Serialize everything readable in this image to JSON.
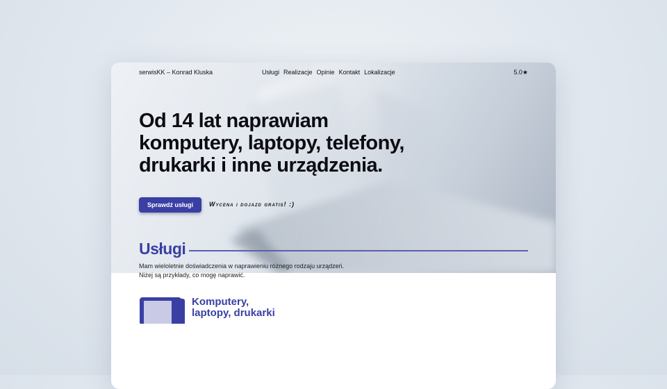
{
  "nav": {
    "brand": "serwisKK – Konrad Kluska",
    "menu": [
      "Usługi",
      "Realizacje",
      "Opinie",
      "Kontakt",
      "Lokalizacje"
    ],
    "rating": "5.0★"
  },
  "hero": {
    "title": "Od 14 lat naprawiam komputery, laptopy, telefony, drukarki i inne urządzenia.",
    "cta_label": "Sprawdź usługi",
    "cta_note": "Wycena i dojazd gratis! :)"
  },
  "services": {
    "heading": "Usługi",
    "intro_line1": "Mam wieloletnie doświadczenia w naprawieniu różnego rodzaju urządzeń.",
    "intro_line2": "Niżej są przykłady, co mogę naprawić.",
    "first_item_title": "Komputery, laptopy, drukarki"
  },
  "colors": {
    "accent": "#3a3fa3"
  }
}
